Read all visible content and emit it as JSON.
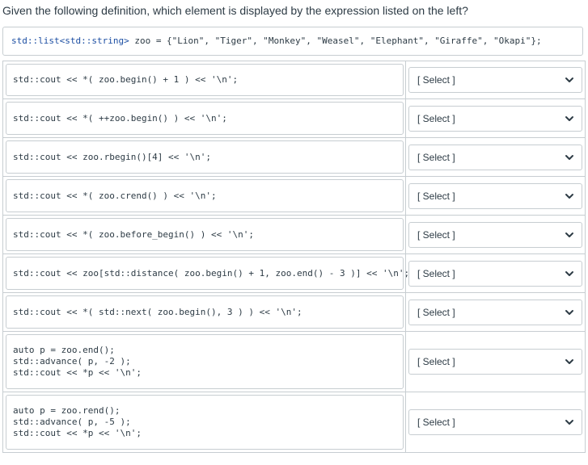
{
  "question": "Given the following definition, which element is displayed by the expression listed on the left?",
  "definition": {
    "prefix": "std::list<std::string>",
    "rest": " zoo = {\"Lion\", \"Tiger\", \"Monkey\", \"Weasel\", \"Elephant\", \"Giraffe\", \"Okapi\"};"
  },
  "rows": [
    {
      "lines": [
        "std::cout << *( zoo.begin() + 1 ) << '\\n';"
      ],
      "select": "[ Select ]"
    },
    {
      "lines": [
        "std::cout << *( ++zoo.begin() ) << '\\n';"
      ],
      "select": "[ Select ]"
    },
    {
      "lines": [
        "std::cout << zoo.rbegin()[4] << '\\n';"
      ],
      "select": "[ Select ]"
    },
    {
      "lines": [
        "std::cout << *( zoo.crend() ) << '\\n';"
      ],
      "select": "[ Select ]"
    },
    {
      "lines": [
        "std::cout << *( zoo.before_begin() ) << '\\n';"
      ],
      "select": "[ Select ]"
    },
    {
      "lines": [
        "std::cout << zoo[std::distance( zoo.begin() + 1, zoo.end() - 3 )] << '\\n';"
      ],
      "select": "[ Select ]"
    },
    {
      "lines": [
        "std::cout << *( std::next( zoo.begin(), 3 ) ) << '\\n';"
      ],
      "select": "[ Select ]"
    },
    {
      "lines": [
        "auto p = zoo.end();",
        "std::advance( p, -2 );",
        "std::cout << *p << '\\n';"
      ],
      "select": "[ Select ]"
    },
    {
      "lines": [
        "auto p = zoo.rend();",
        "std::advance( p, -5 );",
        "std::cout << *p << '\\n';"
      ],
      "select": "[ Select ]"
    }
  ],
  "icons": {
    "dropdown": "chevron-down-icon"
  },
  "colors": {
    "text": "#2d3b45",
    "border": "#c7cdd1",
    "keyword": "#1d4fa3",
    "string": "#a1262d"
  }
}
